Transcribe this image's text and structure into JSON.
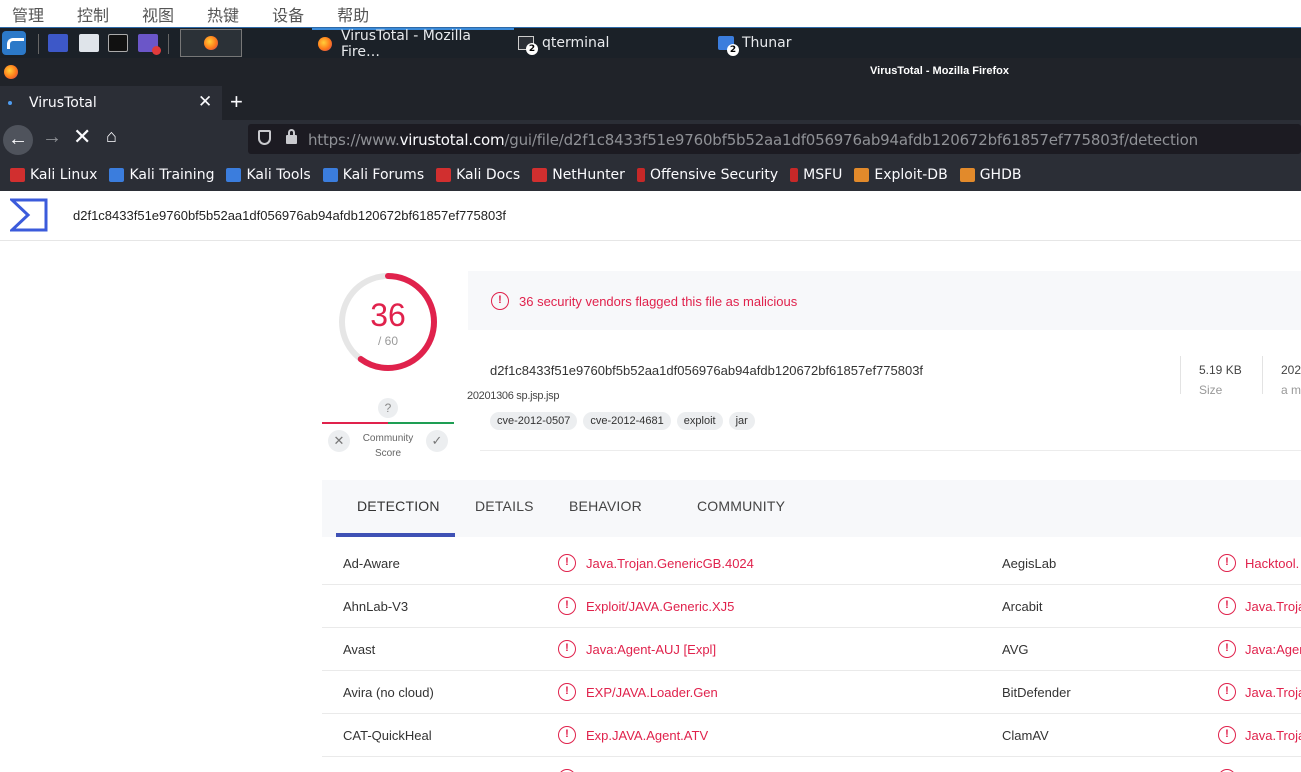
{
  "host_menu": [
    "管理",
    "控制",
    "视图",
    "热键",
    "设备",
    "帮助"
  ],
  "taskbar": {
    "tasks": [
      {
        "label": "VirusTotal - Mozilla Fire…"
      },
      {
        "label": "qterminal",
        "badge": "2"
      },
      {
        "label": "Thunar",
        "badge": "2"
      }
    ]
  },
  "window_title": "VirusTotal - Mozilla Firefox",
  "browser": {
    "tab_label": "VirusTotal",
    "url_prefix": "https://www.",
    "url_domain": "virustotal.com",
    "url_path": "/gui/file/d2f1c8433f51e9760bf5b52aa1df056976ab94afdb120672bf61857ef775803f/detection",
    "bookmarks": [
      {
        "label": "Kali Linux",
        "color": "#d12f2f"
      },
      {
        "label": "Kali Training",
        "color": "#3b7ddd"
      },
      {
        "label": "Kali Tools",
        "color": "#3b7ddd"
      },
      {
        "label": "Kali Forums",
        "color": "#3b7ddd"
      },
      {
        "label": "Kali Docs",
        "color": "#d12f2f"
      },
      {
        "label": "NetHunter",
        "color": "#d12f2f"
      },
      {
        "label": "Offensive Security",
        "color": "#c62828"
      },
      {
        "label": "MSFU",
        "color": "#c62828"
      },
      {
        "label": "Exploit-DB",
        "color": "#e28a2b"
      },
      {
        "label": "GHDB",
        "color": "#e28a2b"
      }
    ]
  },
  "vt": {
    "search_hash": "d2f1c8433f51e9760bf5b52aa1df056976ab94afdb120672bf61857ef775803f",
    "score": {
      "detected": 36,
      "total": "/ 60",
      "fraction": 0.6
    },
    "community": {
      "unknown": "?",
      "label": "Community Score"
    },
    "alert": "36 security vendors flagged this file as malicious",
    "file_hash": "d2f1c8433f51e9760bf5b52aa1df056976ab94afdb120672bf61857ef775803f",
    "file_name": "20201306 sp.jsp.jsp",
    "tags": [
      "cve-2012-0507",
      "cve-2012-4681",
      "exploit",
      "jar"
    ],
    "size_value": "5.19 KB",
    "size_label": "Size",
    "date_value": "202",
    "date_label": "a m",
    "tabs": [
      "DETECTION",
      "DETAILS",
      "BEHAVIOR",
      "COMMUNITY"
    ],
    "detections": [
      {
        "vendor": "Ad-Aware",
        "result": "Java.Trojan.GenericGB.4024",
        "vendor2": "AegisLab",
        "result2": "Hacktool."
      },
      {
        "vendor": "AhnLab-V3",
        "result": "Exploit/JAVA.Generic.XJ5",
        "vendor2": "Arcabit",
        "result2": "Java.Troja"
      },
      {
        "vendor": "Avast",
        "result": "Java:Agent-AUJ [Expl]",
        "vendor2": "AVG",
        "result2": "Java:Agen"
      },
      {
        "vendor": "Avira (no cloud)",
        "result": "EXP/JAVA.Loader.Gen",
        "vendor2": "BitDefender",
        "result2": "Java.Troja"
      },
      {
        "vendor": "CAT-QuickHeal",
        "result": "Exp.JAVA.Agent.ATV",
        "vendor2": "ClamAV",
        "result2": "Java.Troja"
      }
    ]
  },
  "colors": {
    "malicious": "#e0224c",
    "accent": "#3f51b5",
    "harmless": "#1e9e54"
  }
}
